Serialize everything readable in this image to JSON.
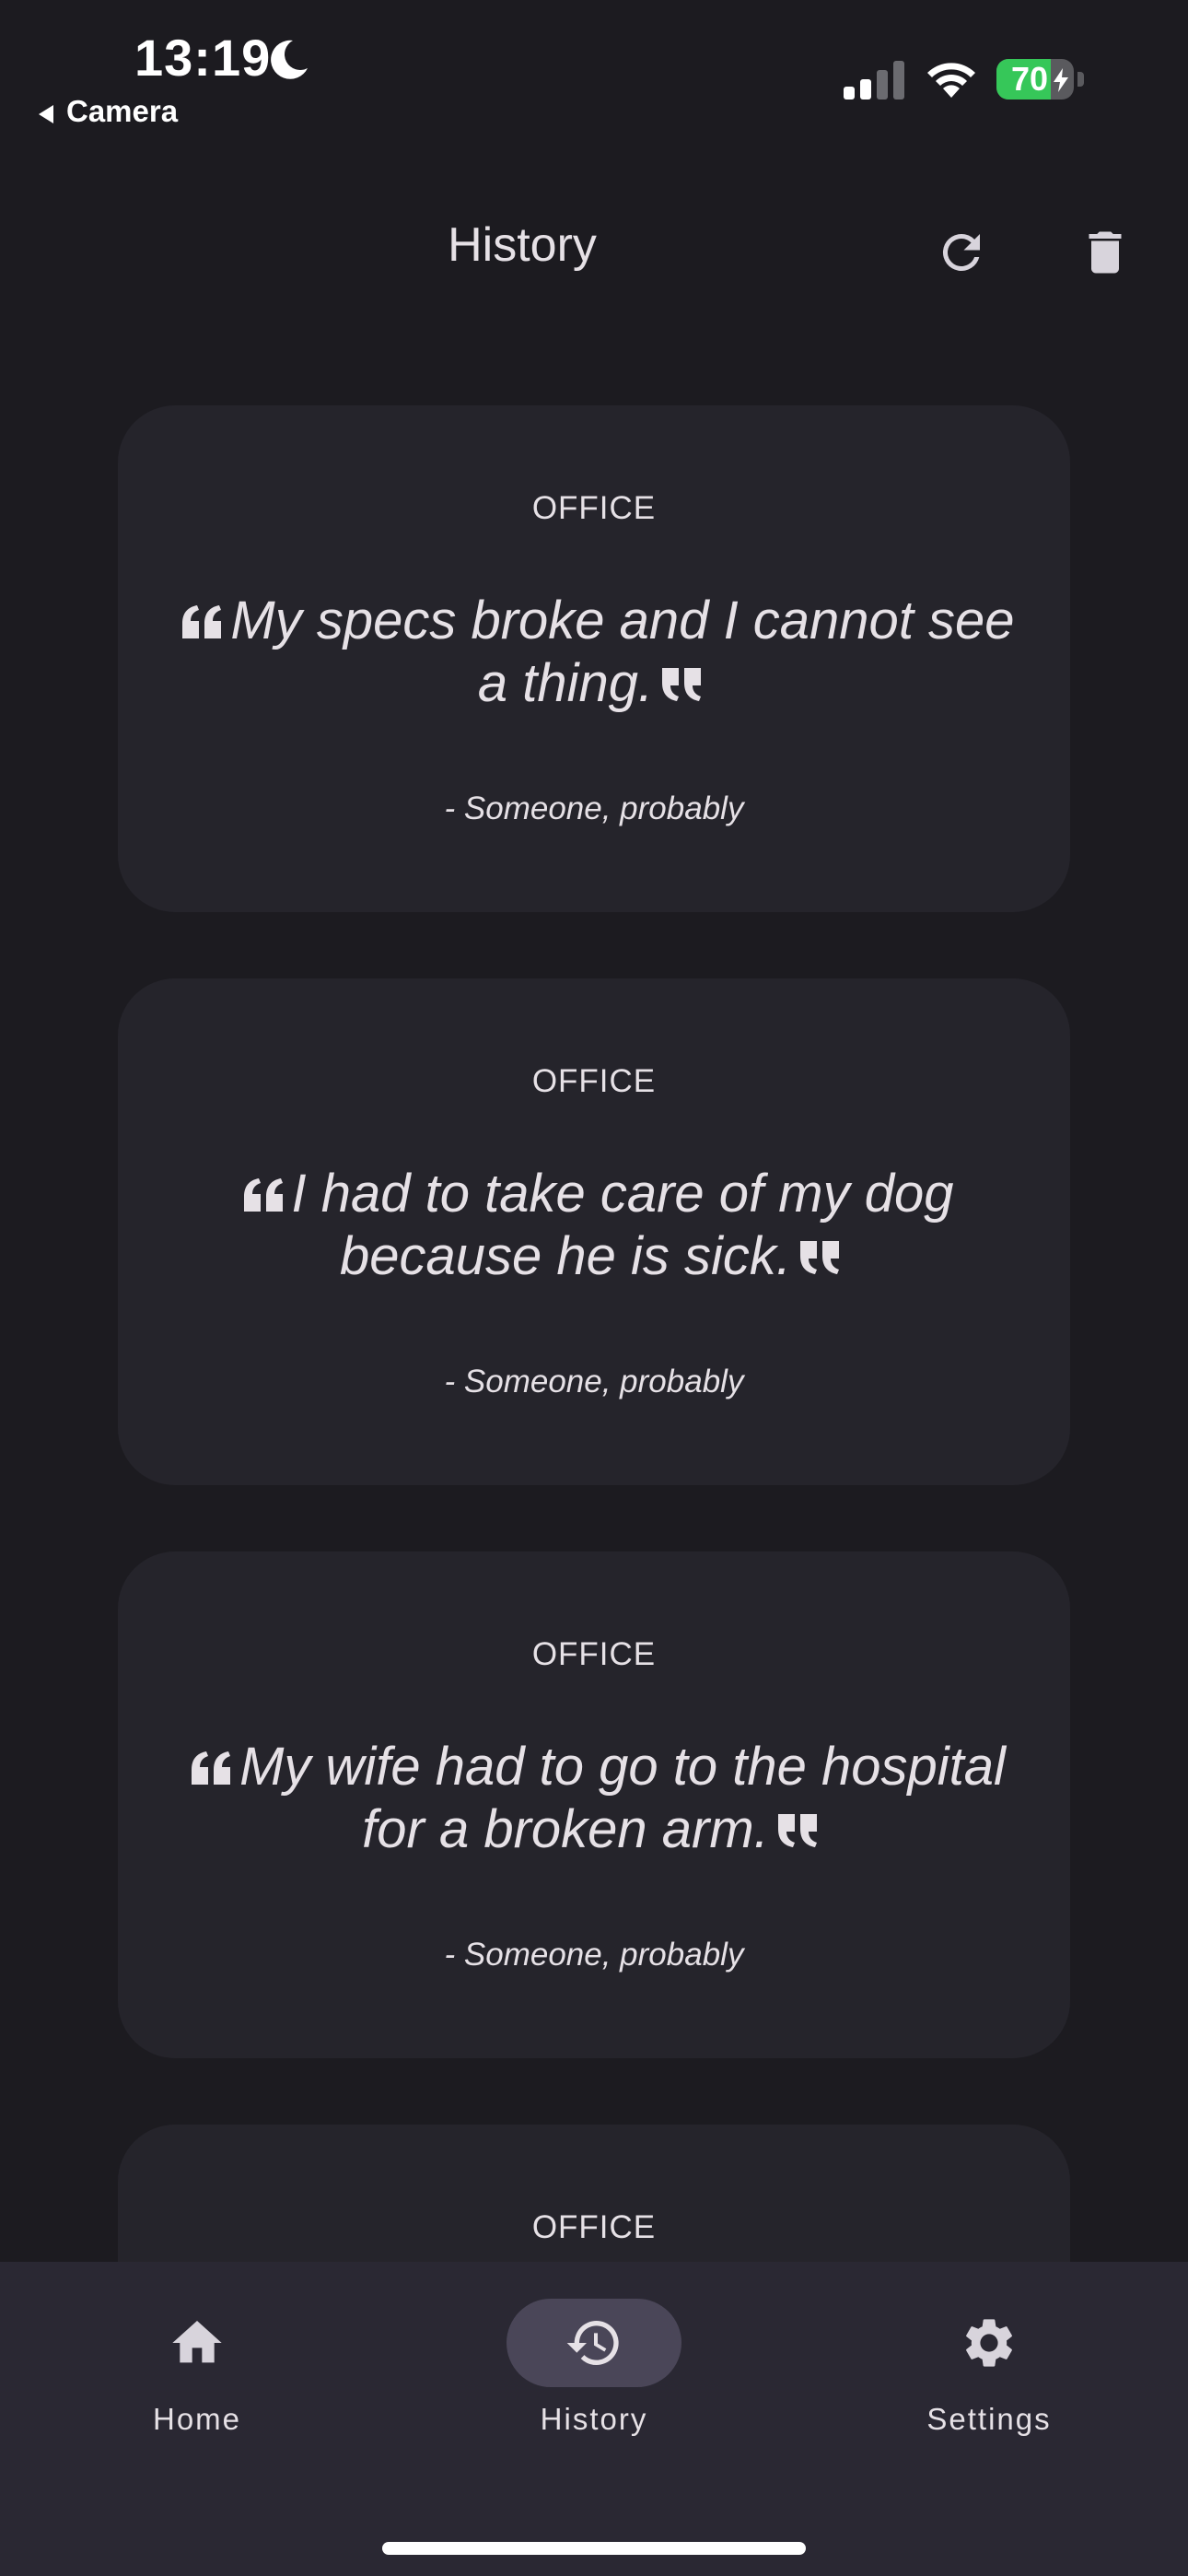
{
  "status_bar": {
    "time": "13:19",
    "back_label": "Camera",
    "battery_level": "70",
    "icons": [
      "moon-icon",
      "signal-icon",
      "wifi-icon",
      "battery-icon"
    ]
  },
  "app_bar": {
    "title": "History",
    "actions": [
      "refresh-icon",
      "delete-icon"
    ]
  },
  "cards": [
    {
      "category": "OFFICE",
      "quote": "My specs broke and I cannot see a thing.",
      "author": "- Someone, probably"
    },
    {
      "category": "OFFICE",
      "quote": "I had to take care of my dog because he is sick.",
      "author": "- Someone, probably"
    },
    {
      "category": "OFFICE",
      "quote": "My wife had to go to the hospital for a broken arm.",
      "author": "- Someone, probably"
    },
    {
      "category": "OFFICE",
      "quote": "",
      "author": ""
    }
  ],
  "bottom_nav": {
    "items": [
      {
        "label": "Home",
        "icon": "home-icon",
        "active": false
      },
      {
        "label": "History",
        "icon": "history-icon",
        "active": true
      },
      {
        "label": "Settings",
        "icon": "settings-icon",
        "active": false
      }
    ]
  },
  "colors": {
    "background": "#1c1b20",
    "card": "#25242b",
    "navbar": "#2a2833",
    "active_pill": "#4a4658",
    "battery": "#36c759"
  }
}
